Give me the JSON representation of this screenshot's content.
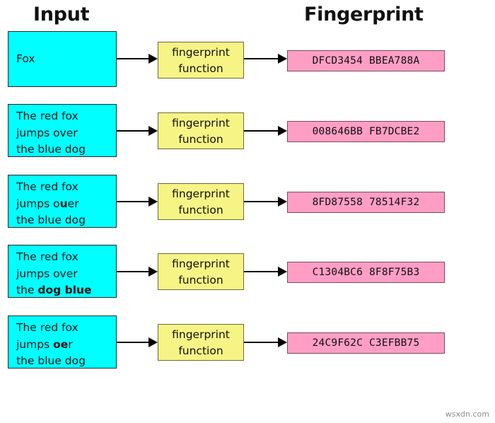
{
  "headers": {
    "input": "Input",
    "fingerprint": "Fingerprint"
  },
  "function_label": {
    "line1": "fingerprint",
    "line2": "function"
  },
  "rows": [
    {
      "input_lines": [
        "Fox"
      ],
      "input_plain": "Fox",
      "function": "fingerprint function",
      "output": "DFCD3454 BBEA788A"
    },
    {
      "input_lines": [
        "The red fox",
        "jumps over",
        "the blue dog"
      ],
      "input_plain": "The red fox jumps over the blue dog",
      "function": "fingerprint function",
      "output": "008646BB FB7DCBE2"
    },
    {
      "input_lines": [
        "The red fox",
        "jumps o<b>u</b>er",
        "the blue dog"
      ],
      "input_plain": "The red fox jumps ouer the blue dog",
      "highlighted": "u",
      "function": "fingerprint function",
      "output": "8FD87558 78514F32"
    },
    {
      "input_lines": [
        "The red fox",
        "jumps over",
        "the <b>dog blue</b>"
      ],
      "input_plain": "The red fox jumps over the dog blue",
      "highlighted": "dog blue",
      "function": "fingerprint function",
      "output": "C1304BC6 8F8F75B3"
    },
    {
      "input_lines": [
        "The red fox",
        "jumps <b>oe</b>r",
        "the blue dog"
      ],
      "input_plain": "The red fox jumps oer the blue dog",
      "highlighted": "oe",
      "function": "fingerprint function",
      "output": "24C9F62C C3EFBB75"
    }
  ],
  "watermark": "wsxdn.com",
  "colors": {
    "input_box": "#00FFFF",
    "function_box": "#F7F486",
    "output_box": "#FF9EC4",
    "arrow": "#000000",
    "text": "#111111"
  }
}
